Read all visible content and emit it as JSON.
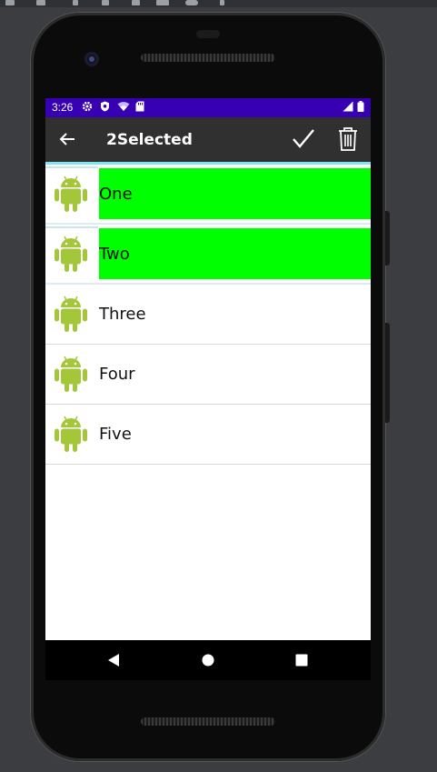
{
  "status_bar": {
    "time": "3:26"
  },
  "app_bar": {
    "title": "2Selected"
  },
  "list": {
    "items": [
      {
        "label": "One",
        "selected": true
      },
      {
        "label": "Two",
        "selected": true
      },
      {
        "label": "Three",
        "selected": false
      },
      {
        "label": "Four",
        "selected": false
      },
      {
        "label": "Five",
        "selected": false
      }
    ]
  },
  "colors": {
    "status_bar": "#3700b3",
    "app_bar": "#303030",
    "selected_highlight": "#00ff00",
    "android_green": "#a4c639"
  },
  "icons": {
    "back": "arrow-left-icon",
    "confirm": "check-icon",
    "delete": "trash-icon",
    "item": "android-robot-icon",
    "nav_back": "triangle-back-icon",
    "nav_home": "circle-home-icon",
    "nav_recents": "square-recents-icon"
  }
}
